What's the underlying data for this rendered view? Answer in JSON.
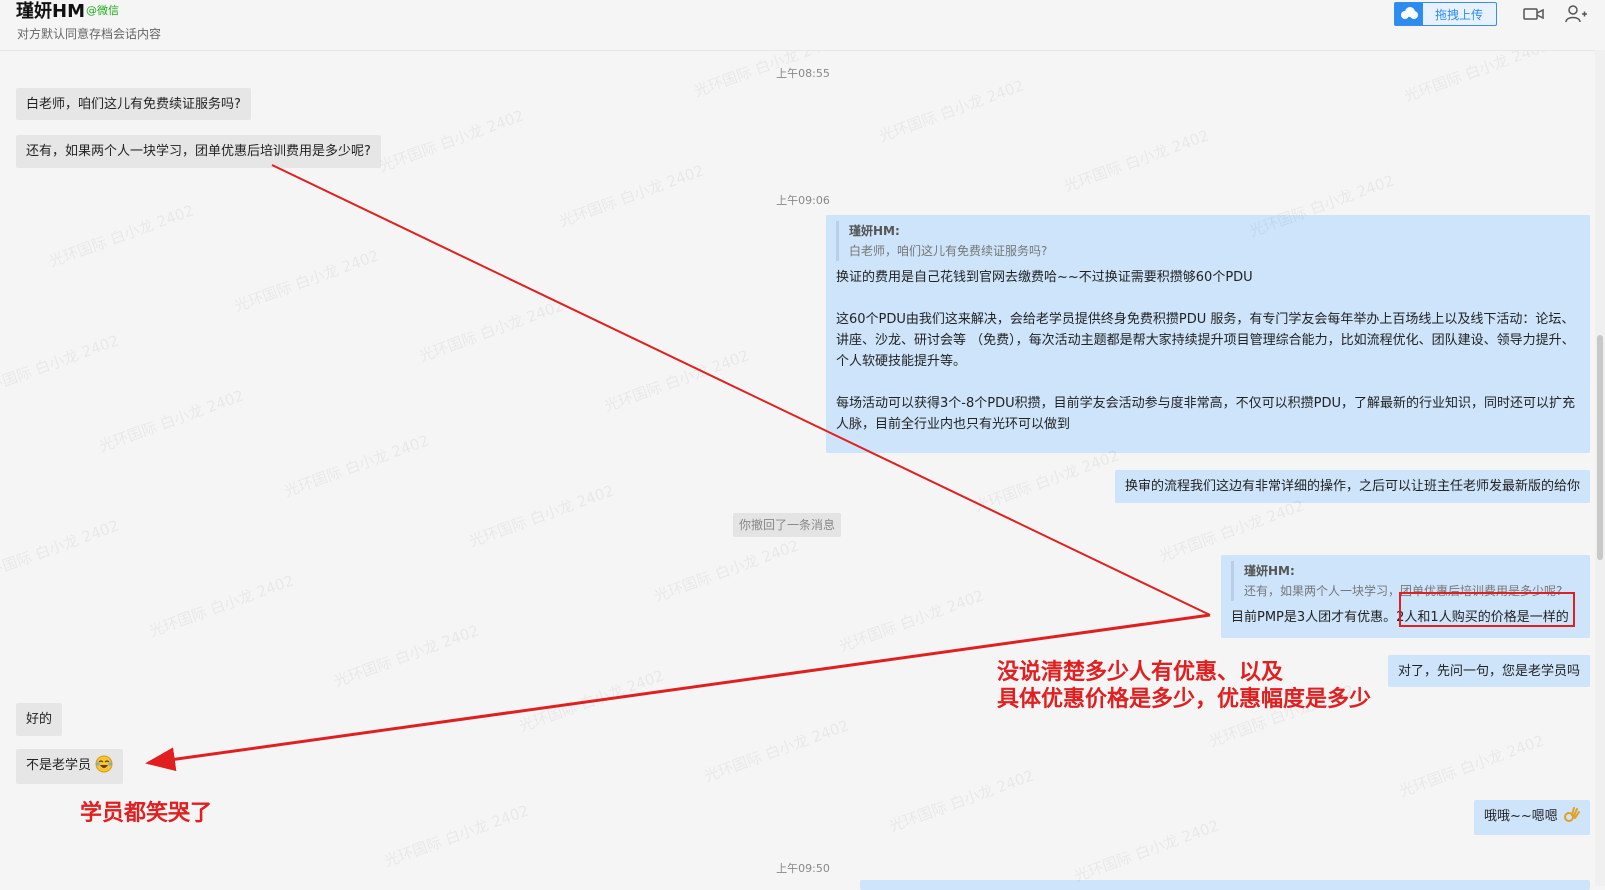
{
  "header": {
    "contact_name": "瑾妍HM",
    "contact_tag": "@微信",
    "sub_note": "对方默认同意存档会话内容",
    "upload_label": "拖拽上传",
    "video_icon": "video-call-icon",
    "add_user_icon": "add-user-icon"
  },
  "timestamps": [
    "上午08:55",
    "上午09:06",
    "上午09:50"
  ],
  "messages": {
    "m1": "白老师，咱们这儿有免费续证服务吗?",
    "m2": "还有，如果两个人一块学习，团单优惠后培训费用是多少呢?",
    "m3": {
      "quote_name": "瑾妍HM:",
      "quote_text": "白老师，咱们这儿有免费续证服务吗?",
      "p1": "换证的费用是自己花钱到官网去缴费哈~~不过换证需要积攒够60个PDU",
      "p2": "这60个PDU由我们这来解决，会给老学员提供终身免费积攒PDU 服务，有专门学友会每年举办上百场线上以及线下活动：论坛、讲座、沙龙、研讨会等 （免费），每次活动主题都是帮大家持续提升项目管理综合能力，比如流程优化、团队建设、领导力提升、个人软硬技能提升等。",
      "p3": "每场活动可以获得3个-8个PDU积攒，目前学友会活动参与度非常高，不仅可以积攒PDU，了解最新的行业知识，同时还可以扩充人脉，目前全行业内也只有光环可以做到"
    },
    "m4": "换审的流程我们这边有非常详细的操作，之后可以让班主任老师发最新版的给你",
    "recall_notice": "你撤回了一条消息",
    "m5": {
      "quote_name": "瑾妍HM:",
      "quote_text": "还有，如果两个人一块学习，团单优惠后培训费用是多少呢?",
      "text": "目前PMP是3人团才有优惠。2人和1人购买的价格是一样的"
    },
    "m6": "对了，先问一句，您是老学员吗",
    "m7": "好的",
    "m8": "不是老学员",
    "m9": "哦哦~~嗯嗯"
  },
  "annotations": {
    "a1_line1": "没说清楚多少人有优惠、以及",
    "a1_line2": "具体优惠价格是多少，优惠幅度是多少",
    "a2": "学员都笑哭了"
  },
  "watermark_text": "光环国际 白小龙 2402",
  "colors": {
    "incoming_bubble": "#e6e6e6",
    "outgoing_bubble": "#cde4fb",
    "annotation_red": "#e02020",
    "brand_blue": "#2d8cf0"
  }
}
